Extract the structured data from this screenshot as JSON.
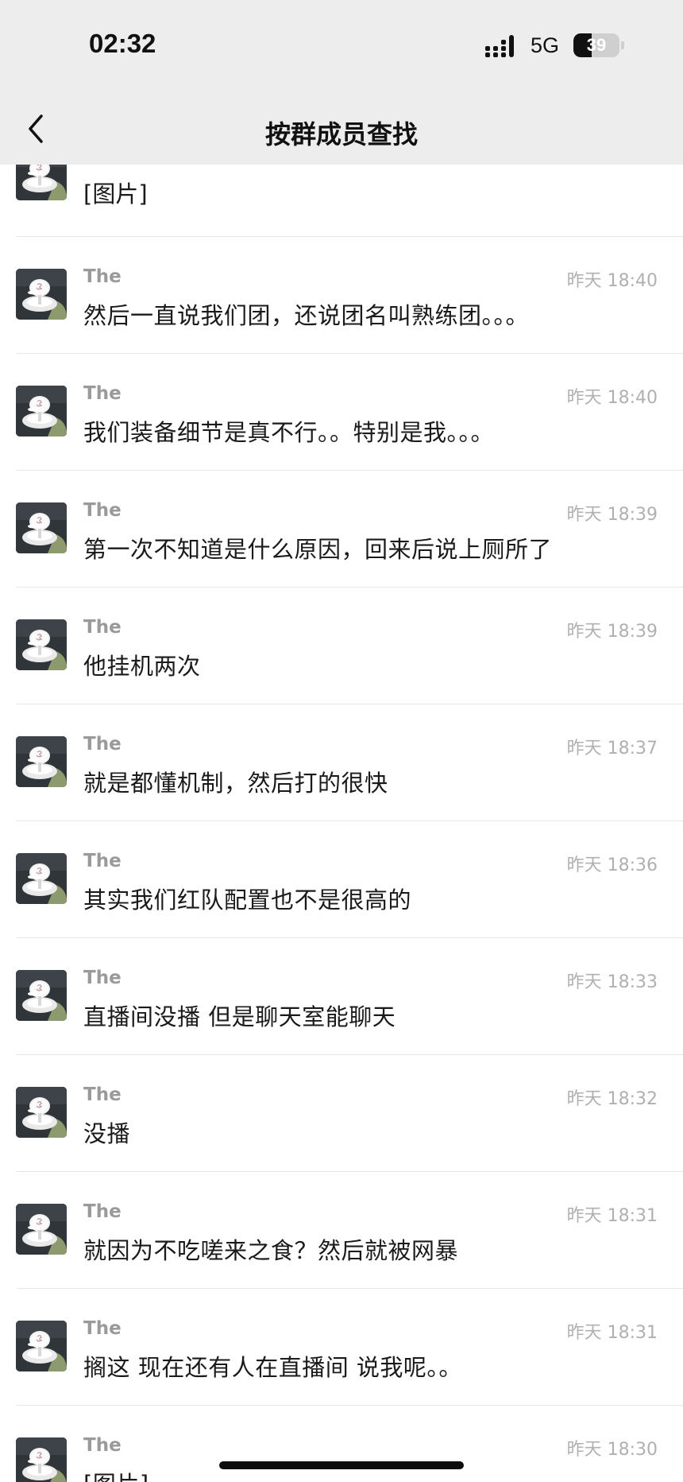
{
  "status_bar": {
    "time": "02:32",
    "network": "5G",
    "battery": "39",
    "battery_level": 0.39
  },
  "nav": {
    "title": "按群成员查找",
    "back_icon": "chevron-left-icon"
  },
  "first_message": {
    "text": "[图片]"
  },
  "messages": [
    {
      "name": "The",
      "time": "昨天 18:40",
      "text": "然后一直说我们团，还说团名叫熟练团。。。"
    },
    {
      "name": "The",
      "time": "昨天 18:40",
      "text": "我们装备细节是真不行。。特别是我。。。"
    },
    {
      "name": "The",
      "time": "昨天 18:39",
      "text": "第一次不知道是什么原因，回来后说上厕所了"
    },
    {
      "name": "The",
      "time": "昨天 18:39",
      "text": "他挂机两次"
    },
    {
      "name": "The",
      "time": "昨天 18:37",
      "text": "就是都懂机制，然后打的很快"
    },
    {
      "name": "The",
      "time": "昨天 18:36",
      "text": "其实我们红队配置也不是很高的"
    },
    {
      "name": "The",
      "time": "昨天 18:33",
      "text": "直播间没播 但是聊天室能聊天"
    },
    {
      "name": "The",
      "time": "昨天 18:32",
      "text": "没播"
    },
    {
      "name": "The",
      "time": "昨天 18:31",
      "text": "就因为不吃嗟来之食？然后就被网暴"
    },
    {
      "name": "The",
      "time": "昨天 18:31",
      "text": "搁这 现在还有人在直播间 说我呢。。"
    },
    {
      "name": "The",
      "time": "昨天 18:30",
      "text": "[图片]"
    }
  ]
}
